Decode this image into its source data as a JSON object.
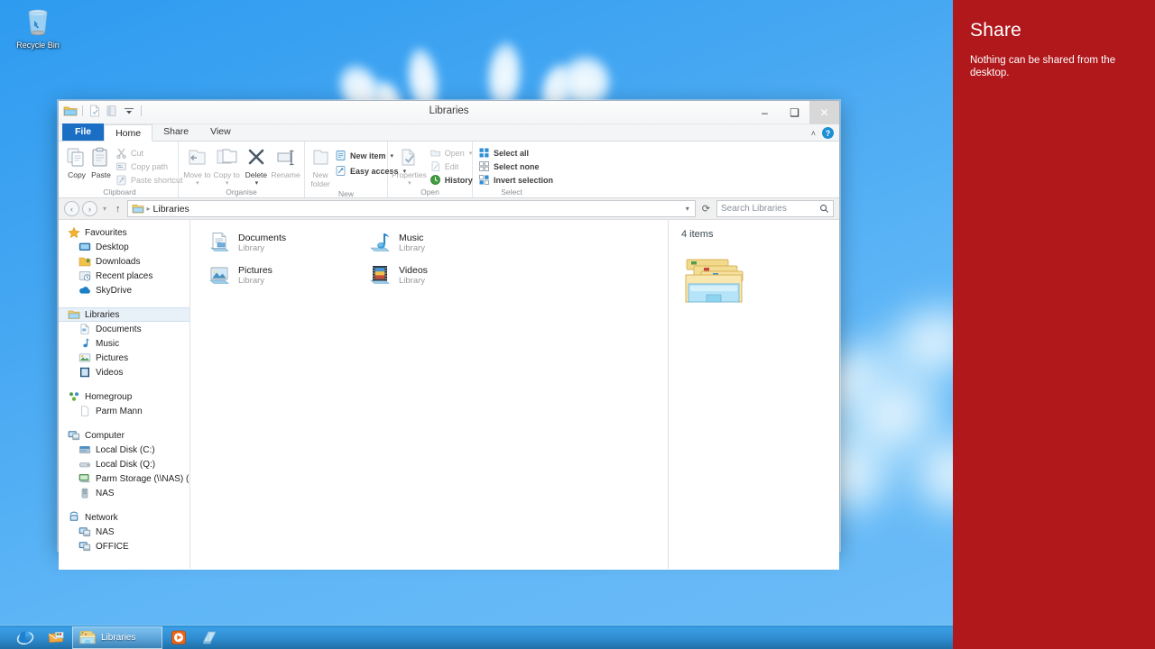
{
  "desktop": {
    "icons": [
      {
        "label": "Recycle Bin",
        "icon": "recycle-bin-icon"
      }
    ]
  },
  "explorer": {
    "title": "Libraries",
    "quick_access": [
      {
        "name": "folder-icon"
      },
      {
        "name": "properties-icon"
      },
      {
        "name": "new-folder-icon"
      },
      {
        "name": "customize-dropdown-icon"
      }
    ],
    "window_buttons": {
      "minimize": "–",
      "maximize": "❑",
      "close": "✕"
    },
    "tabs": [
      {
        "label": "File",
        "kind": "file"
      },
      {
        "label": "Home",
        "kind": "active"
      },
      {
        "label": "Share",
        "kind": "normal"
      },
      {
        "label": "View",
        "kind": "normal"
      }
    ],
    "ribbon_controls": {
      "collapse": "˄",
      "help": "?"
    },
    "ribbon_groups": [
      {
        "title": "Clipboard",
        "big_buttons": [
          {
            "label": "Copy",
            "icon": "copy-icon",
            "dim": false
          },
          {
            "label": "Paste",
            "icon": "paste-icon",
            "dim": false
          }
        ],
        "small_buttons": [
          {
            "label": "Cut",
            "icon": "cut-icon",
            "dim": true
          },
          {
            "label": "Copy path",
            "icon": "copy-path-icon",
            "dim": true
          },
          {
            "label": "Paste shortcut",
            "icon": "paste-shortcut-icon",
            "dim": true
          }
        ]
      },
      {
        "title": "Organise",
        "big_buttons": [
          {
            "label": "Move to",
            "icon": "move-to-icon",
            "caret": true,
            "dim": true
          },
          {
            "label": "Copy to",
            "icon": "copy-to-icon",
            "caret": true,
            "dim": true
          },
          {
            "label": "Delete",
            "icon": "delete-icon",
            "caret": true,
            "dim": false
          },
          {
            "label": "Rename",
            "icon": "rename-icon",
            "dim": true
          }
        ],
        "small_buttons": []
      },
      {
        "title": "New",
        "big_buttons": [
          {
            "label": "New folder",
            "icon": "new-folder-icon",
            "dim": true
          }
        ],
        "small_buttons": [
          {
            "label": "New item",
            "icon": "new-item-icon",
            "caret": true,
            "dim": false
          },
          {
            "label": "Easy access",
            "icon": "easy-access-icon",
            "caret": true,
            "dim": false
          }
        ]
      },
      {
        "title": "Open",
        "big_buttons": [
          {
            "label": "Properties",
            "icon": "properties-icon",
            "caret": true,
            "dim": true
          }
        ],
        "small_buttons": [
          {
            "label": "Open",
            "icon": "open-icon",
            "caret": true,
            "dim": true
          },
          {
            "label": "Edit",
            "icon": "edit-icon",
            "dim": true
          },
          {
            "label": "History",
            "icon": "history-icon",
            "dim": false
          }
        ]
      },
      {
        "title": "Select",
        "big_buttons": [],
        "small_buttons": [
          {
            "label": "Select all",
            "icon": "select-all-icon",
            "dim": false
          },
          {
            "label": "Select none",
            "icon": "select-none-icon",
            "dim": false
          },
          {
            "label": "Invert selection",
            "icon": "invert-selection-icon",
            "dim": false
          }
        ]
      }
    ],
    "address_bar": {
      "back": "‹",
      "forward": "›",
      "recent_caret": "▾",
      "up": "↑",
      "breadcrumb_icon": "libraries-icon",
      "breadcrumb_separator": "▸",
      "breadcrumb_text": "Libraries",
      "breadcrumb_dropdown": "▾",
      "refresh": "⟳",
      "search_placeholder": "Search Libraries",
      "search_value": "",
      "search_icon": "⚲"
    },
    "nav_pane": [
      {
        "label": "Favourites",
        "icon": "star-icon",
        "level": 0,
        "selected": false
      },
      {
        "label": "Desktop",
        "icon": "desktop-icon",
        "level": 1,
        "selected": false
      },
      {
        "label": "Downloads",
        "icon": "downloads-icon",
        "level": 1,
        "selected": false
      },
      {
        "label": "Recent places",
        "icon": "recent-places-icon",
        "level": 1,
        "selected": false
      },
      {
        "label": "SkyDrive",
        "icon": "skydrive-icon",
        "level": 1,
        "selected": false
      },
      {
        "gap": true
      },
      {
        "label": "Libraries",
        "icon": "libraries-icon",
        "level": 0,
        "selected": true
      },
      {
        "label": "Documents",
        "icon": "documents-icon",
        "level": 1,
        "selected": false
      },
      {
        "label": "Music",
        "icon": "music-icon",
        "level": 1,
        "selected": false
      },
      {
        "label": "Pictures",
        "icon": "pictures-icon",
        "level": 1,
        "selected": false
      },
      {
        "label": "Videos",
        "icon": "videos-icon",
        "level": 1,
        "selected": false
      },
      {
        "gap": true
      },
      {
        "label": "Homegroup",
        "icon": "homegroup-icon",
        "level": 0,
        "selected": false
      },
      {
        "label": "Parm Mann",
        "icon": "user-icon",
        "level": 1,
        "selected": false
      },
      {
        "gap": true
      },
      {
        "label": "Computer",
        "icon": "computer-icon",
        "level": 0,
        "selected": false
      },
      {
        "label": "Local Disk (C:)",
        "icon": "hard-drive-icon",
        "level": 1,
        "selected": false
      },
      {
        "label": "Local Disk (Q:)",
        "icon": "disk-icon",
        "level": 1,
        "selected": false
      },
      {
        "label": "Parm Storage (\\\\NAS) (S:)",
        "icon": "network-drive-icon",
        "level": 1,
        "selected": false
      },
      {
        "label": "NAS",
        "icon": "nas-device-icon",
        "level": 1,
        "selected": false
      },
      {
        "gap": true
      },
      {
        "label": "Network",
        "icon": "network-icon",
        "level": 0,
        "selected": false
      },
      {
        "label": "NAS",
        "icon": "network-computer-icon",
        "level": 1,
        "selected": false
      },
      {
        "label": "OFFICE",
        "icon": "network-computer-icon",
        "level": 1,
        "selected": false
      }
    ],
    "items": [
      {
        "name": "Documents",
        "sub": "Library",
        "icon": "documents-library-icon"
      },
      {
        "name": "Music",
        "sub": "Library",
        "icon": "music-library-icon"
      },
      {
        "name": "Pictures",
        "sub": "Library",
        "icon": "pictures-library-icon"
      },
      {
        "name": "Videos",
        "sub": "Library",
        "icon": "videos-library-icon"
      }
    ],
    "details_pane": {
      "count": "4 items",
      "icon": "libraries-large-icon"
    }
  },
  "share_charm": {
    "title": "Share",
    "message": "Nothing can be shared from the desktop.",
    "background": "#b0181c"
  },
  "taskbar": {
    "buttons": [
      {
        "label": "",
        "icon": "internet-explorer-icon",
        "running": false
      },
      {
        "label": "",
        "icon": "mail-icon",
        "running": false
      },
      {
        "label": "Libraries",
        "icon": "explorer-icon",
        "running": true
      },
      {
        "label": "",
        "icon": "media-player-icon",
        "running": false
      },
      {
        "label": "",
        "icon": "notepad-icon",
        "running": false
      }
    ]
  },
  "colors": {
    "desktop_blue": "#47a8f2",
    "charm_red": "#b0181c",
    "file_tab_blue": "#1a6fc4",
    "taskbar_blue": "#2f8ccf"
  }
}
